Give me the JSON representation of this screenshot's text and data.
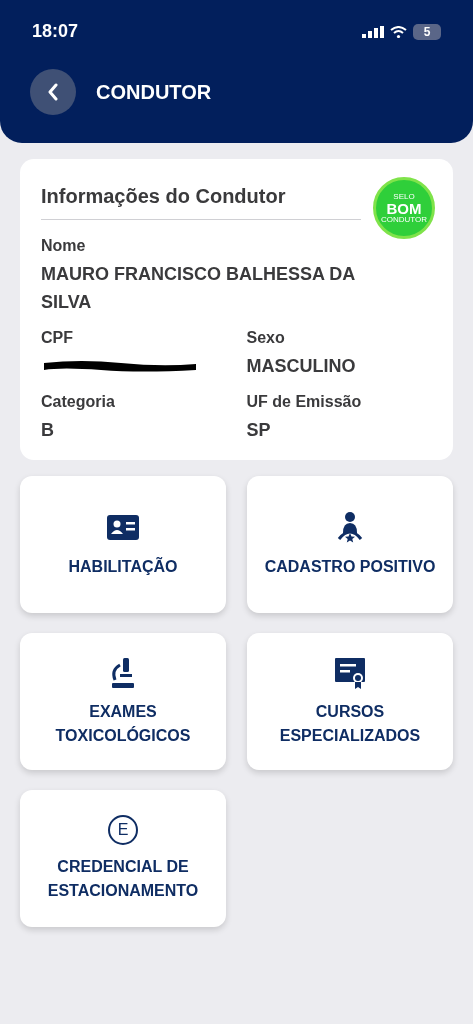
{
  "status_bar": {
    "time": "18:07",
    "battery": "5"
  },
  "header": {
    "title": "CONDUTOR"
  },
  "info_card": {
    "title": "Informações do Condutor",
    "badge": {
      "lines": [
        "SELO",
        "BOM",
        "CONDUTOR"
      ]
    },
    "fields": [
      {
        "kind": "full",
        "label": "Nome",
        "value": "MAURO FRANCISCO BALHESSA DA SILVA"
      },
      {
        "kind": "redacted",
        "label": "CPF"
      },
      {
        "kind": "half",
        "label": "Sexo",
        "value": "MASCULINO"
      },
      {
        "kind": "half",
        "label": "Categoria",
        "value": "B"
      },
      {
        "kind": "half",
        "label": "UF de Emissão",
        "value": "SP"
      }
    ]
  },
  "tiles": [
    {
      "kind": "license",
      "label": "HABILITAÇÃO"
    },
    {
      "kind": "person",
      "label": "CADASTRO POSITIVO"
    },
    {
      "kind": "microscope",
      "label": "EXAMES TOXICOLÓGICOS"
    },
    {
      "kind": "certificate",
      "label": "CURSOS ESPECIALIZADOS"
    },
    {
      "kind": "letter",
      "icon_text": "E",
      "label": "CREDENCIAL DE ESTACIONAMENTO"
    }
  ]
}
